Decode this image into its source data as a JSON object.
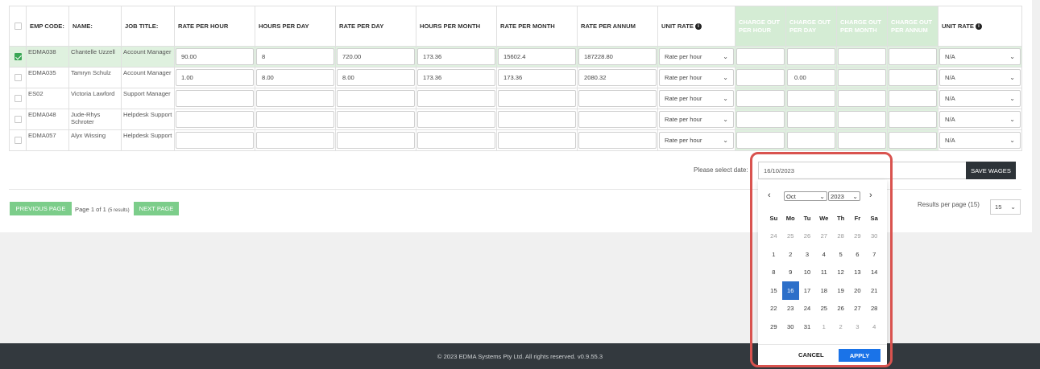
{
  "table": {
    "headers": [
      "",
      "EMP CODE:",
      "NAME:",
      "JOB TITLE:",
      "RATE PER HOUR",
      "HOURS PER DAY",
      "RATE PER DAY",
      "HOURS PER MONTH",
      "RATE PER MONTH",
      "RATE PER ANNUM",
      "UNIT RATE",
      "CHARGE OUT PER HOUR",
      "CHARGE OUT PER DAY",
      "CHARGE OUT PER MONTH",
      "CHARGE OUT PER ANNUM",
      "UNIT RATE"
    ],
    "rows": [
      {
        "checked": true,
        "code": "EDMA038",
        "name": "Chantelle Uzzell",
        "title": "Account Manager",
        "rate_hour": "90.00",
        "hours_day": "8",
        "rate_day": "720.00",
        "hours_month": "173.36",
        "rate_month": "15602.4",
        "rate_annum": "187228.80",
        "unit_rate": "Rate per hour",
        "co_hour": "",
        "co_day": "",
        "co_month": "",
        "co_annum": "",
        "unit_rate2": "N/A"
      },
      {
        "checked": false,
        "code": "EDMA035",
        "name": "Tamryn Schulz",
        "title": "Account Manager",
        "rate_hour": "1.00",
        "hours_day": "8.00",
        "rate_day": "8.00",
        "hours_month": "173.36",
        "rate_month": "173.36",
        "rate_annum": "2080.32",
        "unit_rate": "Rate per hour",
        "co_hour": "",
        "co_day": "0.00",
        "co_month": "",
        "co_annum": "",
        "unit_rate2": "N/A"
      },
      {
        "checked": false,
        "code": "ES02",
        "name": "Victoria Lawford",
        "title": "Support Manager",
        "rate_hour": "",
        "hours_day": "",
        "rate_day": "",
        "hours_month": "",
        "rate_month": "",
        "rate_annum": "",
        "unit_rate": "Rate per hour",
        "co_hour": "",
        "co_day": "",
        "co_month": "",
        "co_annum": "",
        "unit_rate2": "N/A"
      },
      {
        "checked": false,
        "code": "EDMA048",
        "name": "Jude-Rhys Schroter",
        "title": "Helpdesk Support",
        "rate_hour": "",
        "hours_day": "",
        "rate_day": "",
        "hours_month": "",
        "rate_month": "",
        "rate_annum": "",
        "unit_rate": "Rate per hour",
        "co_hour": "",
        "co_day": "",
        "co_month": "",
        "co_annum": "",
        "unit_rate2": "N/A"
      },
      {
        "checked": false,
        "code": "EDMA057",
        "name": "Alyx Wissing",
        "title": "Helpdesk Support",
        "rate_hour": "",
        "hours_day": "",
        "rate_day": "",
        "hours_month": "",
        "rate_month": "",
        "rate_annum": "",
        "unit_rate": "Rate per hour",
        "co_hour": "",
        "co_day": "",
        "co_month": "",
        "co_annum": "",
        "unit_rate2": "N/A"
      }
    ]
  },
  "date_select": {
    "label": "Please select date:",
    "value": "16/10/2023",
    "save_label": "SAVE WAGES"
  },
  "pagination": {
    "prev_label": "PREVIOUS PAGE",
    "info": "Page 1 of 1",
    "results": "(5 results)",
    "next_label": "NEXT PAGE",
    "rpp_label": "Results per page (15)",
    "rpp_value": "15"
  },
  "datepicker": {
    "month": "Oct",
    "year": "2023",
    "dow": [
      "Su",
      "Mo",
      "Tu",
      "We",
      "Th",
      "Fr",
      "Sa"
    ],
    "weeks": [
      [
        "24",
        "25",
        "26",
        "27",
        "28",
        "29",
        "30"
      ],
      [
        "1",
        "2",
        "3",
        "4",
        "5",
        "6",
        "7"
      ],
      [
        "8",
        "9",
        "10",
        "11",
        "12",
        "13",
        "14"
      ],
      [
        "15",
        "16",
        "17",
        "18",
        "19",
        "20",
        "21"
      ],
      [
        "22",
        "23",
        "24",
        "25",
        "26",
        "27",
        "28"
      ],
      [
        "29",
        "30",
        "31",
        "1",
        "2",
        "3",
        "4"
      ]
    ],
    "selected": "16",
    "cancel_label": "CANCEL",
    "apply_label": "APPLY"
  },
  "footer": {
    "text": "© 2023 EDMA Systems Pty Ltd. All rights reserved. v0.9.55.3"
  },
  "colors": {
    "accent_green": "#7ccd8a",
    "header_green": "#d4ecd4",
    "selected_blue": "#2c6fc9",
    "apply_blue": "#1a73e8",
    "highlight_red": "#d9534f",
    "footer_bg": "#33393e"
  }
}
